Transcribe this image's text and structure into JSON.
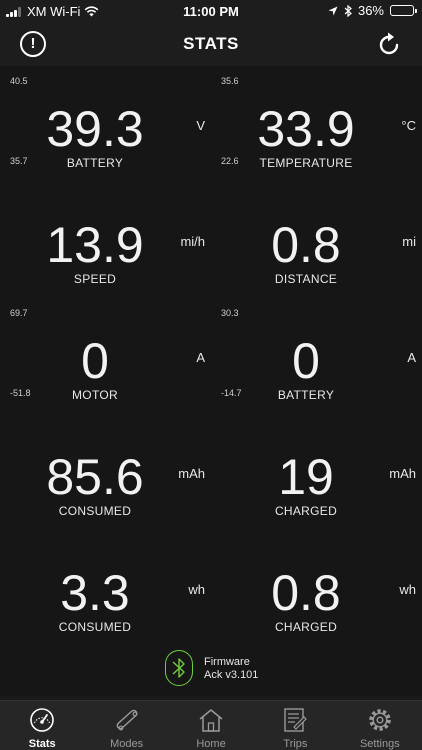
{
  "status_bar": {
    "carrier": "XM Wi-Fi",
    "time": "11:00 PM",
    "battery": "36%",
    "battery_level": 0.36
  },
  "header": {
    "title": "STATS"
  },
  "stats": [
    {
      "value": "39.3",
      "unit": "V",
      "label": "BATTERY",
      "max": "40.5",
      "min": "35.7"
    },
    {
      "value": "33.9",
      "unit": "°C",
      "label": "TEMPERATURE",
      "max": "35.6",
      "min": "22.6"
    },
    {
      "value": "13.9",
      "unit": "mi/h",
      "label": "SPEED",
      "max": "",
      "min": ""
    },
    {
      "value": "0.8",
      "unit": "mi",
      "label": "DISTANCE",
      "max": "",
      "min": ""
    },
    {
      "value": "0",
      "unit": "A",
      "label": "MOTOR",
      "max": "69.7",
      "min": "-51.8"
    },
    {
      "value": "0",
      "unit": "A",
      "label": "BATTERY",
      "max": "30.3",
      "min": "-14.7"
    },
    {
      "value": "85.6",
      "unit": "mAh",
      "label": "CONSUMED",
      "max": "",
      "min": ""
    },
    {
      "value": "19",
      "unit": "mAh",
      "label": "CHARGED",
      "max": "",
      "min": ""
    },
    {
      "value": "3.3",
      "unit": "wh",
      "label": "CONSUMED",
      "max": "",
      "min": ""
    },
    {
      "value": "0.8",
      "unit": "wh",
      "label": "CHARGED",
      "max": "",
      "min": ""
    }
  ],
  "firmware": {
    "line1": "Firmware",
    "line2": "Ack v3.101"
  },
  "tabs": [
    {
      "label": "Stats",
      "icon": "gauge-icon",
      "active": true
    },
    {
      "label": "Modes",
      "icon": "skateboard-icon",
      "active": false
    },
    {
      "label": "Home",
      "icon": "home-icon",
      "active": false
    },
    {
      "label": "Trips",
      "icon": "trips-icon",
      "active": false
    },
    {
      "label": "Settings",
      "icon": "gear-icon",
      "active": false
    }
  ],
  "colors": {
    "background": "#161616",
    "bar": "#1d1d1d",
    "tab_bar": "#262626",
    "bluetooth_accent": "#6fcf3a",
    "inactive_tab": "#9a9a9a"
  }
}
